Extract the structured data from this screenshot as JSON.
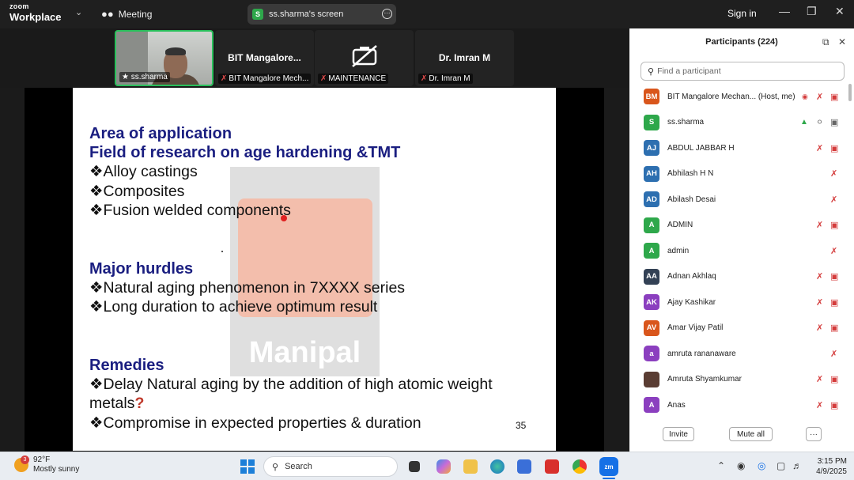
{
  "app": {
    "brand_top": "zoom",
    "brand_bottom": "Workplace",
    "meeting_label": "Meeting",
    "screen_share_label": "ss.sharma's screen",
    "screen_share_initial": "S",
    "signin": "Sign in"
  },
  "gallery": [
    {
      "caption": "ss.sharma",
      "name": "",
      "muted": false,
      "video": true
    },
    {
      "caption": "BIT Mangalore Mech...",
      "name": "BIT  Mangalore...",
      "muted": true,
      "video": false
    },
    {
      "caption": "MAINTENANCE",
      "name": "",
      "muted": true,
      "video": false
    },
    {
      "caption": "Dr. Imran M",
      "name": "Dr. Imran M",
      "muted": true,
      "video": false
    }
  ],
  "slide": {
    "heading1": "Area of application",
    "heading2": "Field of research on age hardening &TMT",
    "items1": [
      "❖Alloy castings",
      "❖Composites",
      "❖Fusion welded components"
    ],
    "heading3": "Major hurdles",
    "items2": [
      "❖Natural aging phenomenon in 7XXXX series",
      "❖Long duration to achieve optimum result"
    ],
    "heading4": "Remedies",
    "rem1a": "❖Delay Natural aging by the addition of high atomic weight",
    "rem1b": "metals",
    "rem1q": "?",
    "rem2": "❖Compromise in expected properties & duration",
    "page_number": "35",
    "watermark": "Manipal"
  },
  "participants": {
    "title": "Participants (224)",
    "search_placeholder": "Find a participant",
    "list": [
      {
        "initials": "BM",
        "name": "BIT Mangalore Mechan... (Host, me)",
        "color": "#d9561c"
      },
      {
        "initials": "S",
        "name": "ss.sharma",
        "color": "#2ea84b"
      },
      {
        "initials": "AJ",
        "name": "ABDUL JABBAR H",
        "color": "#2d6fb0"
      },
      {
        "initials": "AH",
        "name": "Abhilash H N",
        "color": "#2d6fb0"
      },
      {
        "initials": "AD",
        "name": "Abilash Desai",
        "color": "#2d6fb0"
      },
      {
        "initials": "A",
        "name": "ADMIN",
        "color": "#2ea84b"
      },
      {
        "initials": "A",
        "name": "admin",
        "color": "#2ea84b"
      },
      {
        "initials": "AA",
        "name": "Adnan Akhlaq",
        "color": "#334155"
      },
      {
        "initials": "AK",
        "name": "Ajay Kashikar",
        "color": "#8b3fbf"
      },
      {
        "initials": "AV",
        "name": "Amar Vijay Patil",
        "color": "#d9561c"
      },
      {
        "initials": "a",
        "name": "amruta rananaware",
        "color": "#8b3fbf"
      },
      {
        "initials": "",
        "name": "Amruta Shyamkumar",
        "color": "#5a3d33"
      },
      {
        "initials": "A",
        "name": "Anas",
        "color": "#8b3fbf"
      }
    ],
    "invite": "Invite",
    "mute_all": "Mute all",
    "more": "···"
  },
  "taskbar": {
    "temp": "92°F",
    "condition": "Mostly sunny",
    "weather_badge": "3",
    "search": "Search",
    "zoom_app": "zm",
    "time": "3:15 PM",
    "date": "4/9/2025"
  }
}
